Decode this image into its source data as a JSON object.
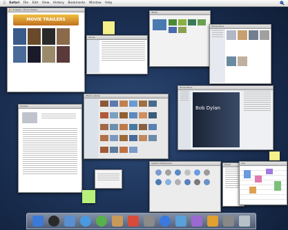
{
  "menubar": {
    "apple_icon": "apple-logo-icon",
    "items": [
      "Safari",
      "File",
      "Edit",
      "View",
      "History",
      "Bookmarks",
      "Window",
      "Help"
    ],
    "spotlight_icon": "spotlight-search-icon"
  },
  "windows": {
    "safari_movies": {
      "title": "Apple - Movie Trailers",
      "heading": "MOVIE TRAILERS"
    },
    "itunes": {
      "title": "iTunes"
    },
    "iphoto": {
      "title": "iPhoto"
    },
    "itunes_store": {
      "title": "iTunes Store"
    },
    "preview_doc": {
      "title": "Preview"
    },
    "photos": {
      "title": "iPhoto Library"
    },
    "bob_dylan": {
      "title": "iTunes Store",
      "artist": "Bob Dylan"
    },
    "system_prefs": {
      "title": "System Preferences"
    },
    "finder": {
      "title": "Finder"
    },
    "ical": {
      "title": "iCal"
    }
  },
  "dock": {
    "icons": [
      "finder-icon",
      "dashboard-icon",
      "mail-icon",
      "safari-icon",
      "ichat-icon",
      "address-book-icon",
      "ical-icon",
      "preview-icon",
      "itunes-icon",
      "iphoto-icon",
      "imovie-icon",
      "garageband-icon",
      "system-preferences-icon",
      "trash-icon"
    ],
    "colors": [
      "#3b7ad8",
      "#2a2a2a",
      "#5a8fd0",
      "#4a9ae0",
      "#58b04a",
      "#c89a5a",
      "#d84a3a",
      "#8a8a8a",
      "#3a7ae0",
      "#5aa0d8",
      "#9a6ad0",
      "#e0a030",
      "#888888",
      "#b8c0c8"
    ]
  },
  "colors": {
    "desktop": "#1d3358",
    "sticky_yellow": "#f5f08a",
    "sticky_green": "#b8f07a"
  }
}
